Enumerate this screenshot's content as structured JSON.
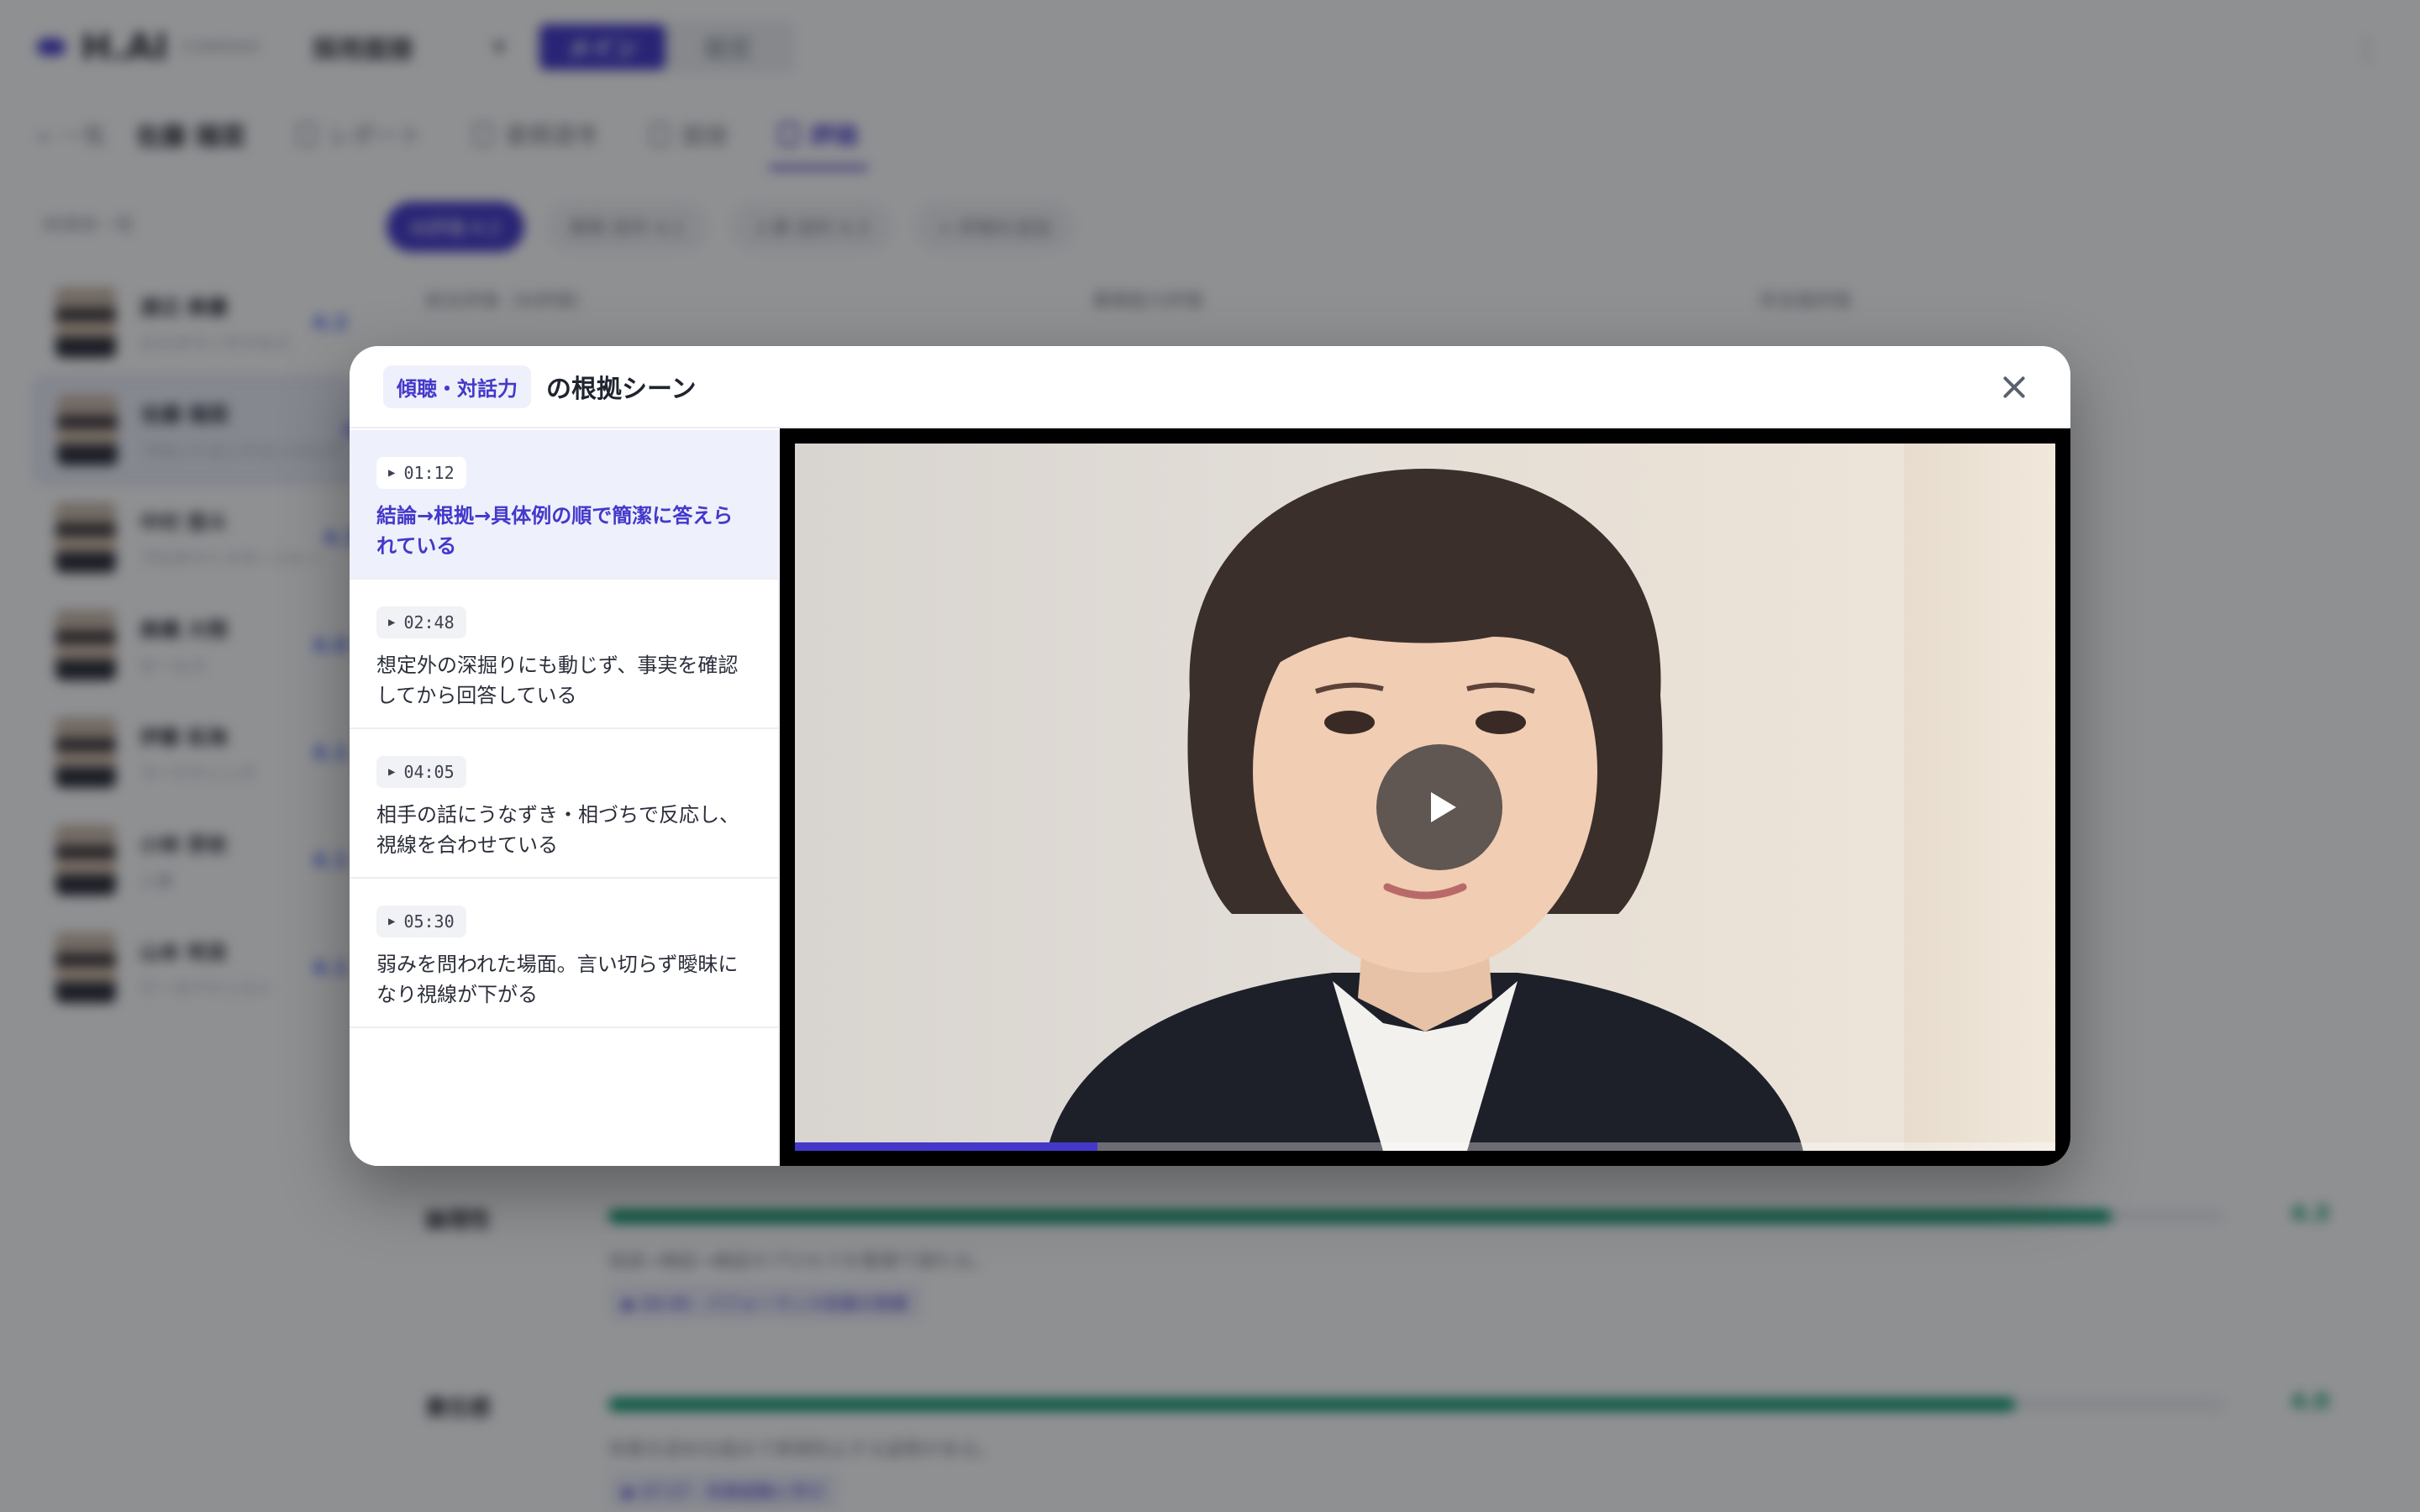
{
  "app": {
    "logo": "H.AI",
    "logo_sub": "COMPANY",
    "department": "採用面接",
    "mode_main": "メイン",
    "mode_settings": "設定"
  },
  "tabs": {
    "back": "← 一覧",
    "candidate": "佐藤 陽菜",
    "items": [
      {
        "label": "レポート"
      },
      {
        "label": "書類選考"
      },
      {
        "label": "面接"
      },
      {
        "label": "評価"
      }
    ]
  },
  "sidebar": {
    "title": "候補者一覧",
    "candidates": [
      {
        "name": "渡辺 美優",
        "role": "カスタマーサクセス",
        "score": "4.2"
      },
      {
        "name": "佐藤 陽菜",
        "role": "フロントエンドエンジニア",
        "score": "4.2"
      },
      {
        "name": "中村 悠斗",
        "role": "プロダクトマネージャー",
        "score": "4.3"
      },
      {
        "name": "高橋 大翔",
        "role": "セールス",
        "score": "4.0"
      },
      {
        "name": "伊藤 拓海",
        "role": "マーケティング",
        "score": "4.1"
      },
      {
        "name": "小林 芽依",
        "role": "人事",
        "score": "4.1"
      },
      {
        "name": "山本 咲良",
        "role": "データアナリスト",
        "score": "4.1"
      }
    ]
  },
  "main": {
    "chips": [
      {
        "label": "AI評価 4.2"
      },
      {
        "label": "開発 田中 4.1"
      },
      {
        "label": "人事 田村 4.3"
      },
      {
        "label": "+ 評価を追加"
      }
    ],
    "sections": [
      "総合評価（AI評価）",
      "業務能力評価",
      "非言語評価"
    ],
    "metrics": [
      {
        "label": "論理性",
        "desc": "仮説→検証→検証のプロセスを整理で語れる。",
        "ev": "▶ 04:40 · パフォーマンス改善の実績",
        "score": "4.3",
        "fill": 0.93
      },
      {
        "label": "責任感",
        "desc": "失敗を認め仕組みで再発防止する姿勢がある。",
        "ev": "▶ 07:27 · 失敗経験と学び",
        "score": "4.0",
        "fill": 0.87
      }
    ]
  },
  "modal": {
    "skill": "傾聴・対話力",
    "title": "の根拠シーン",
    "scenes": [
      {
        "time": "01:12",
        "text": "結論→根拠→具体例の順で簡潔に答えられている"
      },
      {
        "time": "02:48",
        "text": "想定外の深掘りにも動じず、事実を確認してから回答している"
      },
      {
        "time": "04:05",
        "text": "相手の話にうなずき・相づちで反応し、視線を合わせている"
      },
      {
        "time": "05:30",
        "text": "弱みを問われた場面。言い切らず曖昧になり視線が下がる"
      }
    ],
    "video": {
      "progress": 0.24
    }
  },
  "colors": {
    "accent": "#4338ca",
    "score": "#059669"
  }
}
